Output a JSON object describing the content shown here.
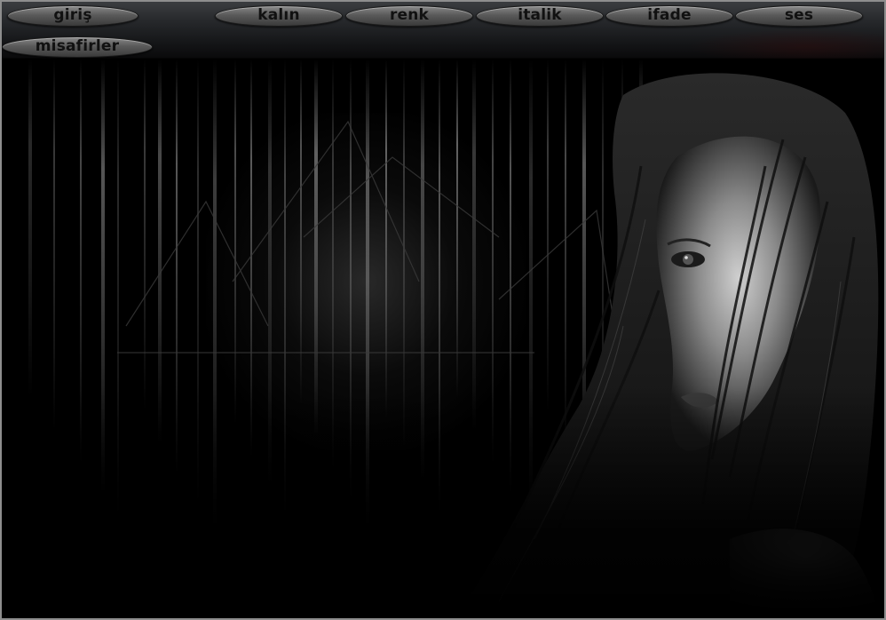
{
  "nav": {
    "items": [
      {
        "label": "giriş"
      },
      {
        "label": "kalın"
      },
      {
        "label": "renk"
      },
      {
        "label": "italik"
      },
      {
        "label": "ifade"
      },
      {
        "label": "ses"
      },
      {
        "label": "misafirler"
      }
    ]
  },
  "hero": {
    "description_icon": "woman-portrait-image",
    "background_icon": "ship-streaks-image"
  },
  "colors": {
    "bar_top": "#3b3d40",
    "bar_bottom": "#0a0a0b",
    "pill_light": "#8a8a8a",
    "pill_dark": "#3a3a3a",
    "frame": "#8e8e8e"
  }
}
